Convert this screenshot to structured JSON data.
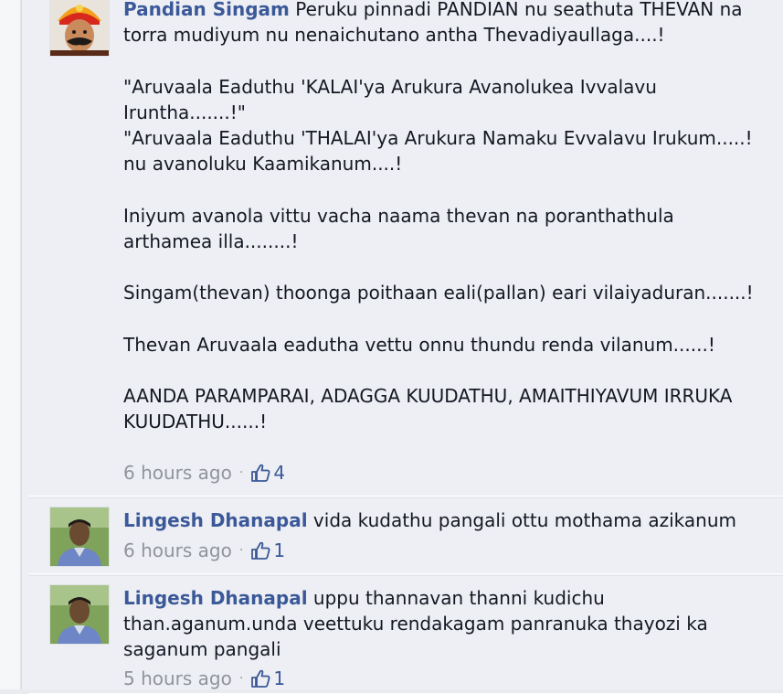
{
  "comments": [
    {
      "author": "Pandian Singam",
      "text": "Peruku pinnadi PANDIAN nu seathuta THEVAN na torra mudiyum nu nenaichutano antha Thevadiyaullaga....!\n\n\"Aruvaala Eaduthu 'KALAI'ya Arukura Avanolukea Ivvalavu Iruntha.......!\"\n\"Aruvaala Eaduthu 'THALAI'ya Arukura Namaku Evvalavu Irukum.....! nu avanoluku Kaamikanum....!\n\nIniyum avanola vittu vacha naama thevan na poranthathula arthamea illa........!\n\nSingam(thevan) thoonga poithaan eali(pallan) eari vilaiyaduran.......!\n\nThevan Aruvaala eadutha vettu onnu thundu renda vilanum......!\n\nAANDA PARAMPARAI, ADAGGA KUUDATHU, AMAITHIYAVUM IRRUKA KUUDATHU......!",
      "time": "6 hours ago",
      "likes": "4"
    },
    {
      "author": "Lingesh Dhanapal",
      "text": "vida kudathu pangali ottu mothama azikanum",
      "time": "6 hours ago",
      "likes": "1"
    },
    {
      "author": "Lingesh Dhanapal",
      "text": "uppu thannavan thanni kudichu than.aganum.unda veettuku rendakagam panranuka thayozi ka saganum pangali",
      "time": "5 hours ago",
      "likes": "1"
    }
  ],
  "separator": "·",
  "icons": {
    "like": "thumbs-up-icon"
  },
  "colors": {
    "author": "#3b5998",
    "text": "#141823",
    "meta": "#90949c",
    "panel": "#edeff4"
  }
}
